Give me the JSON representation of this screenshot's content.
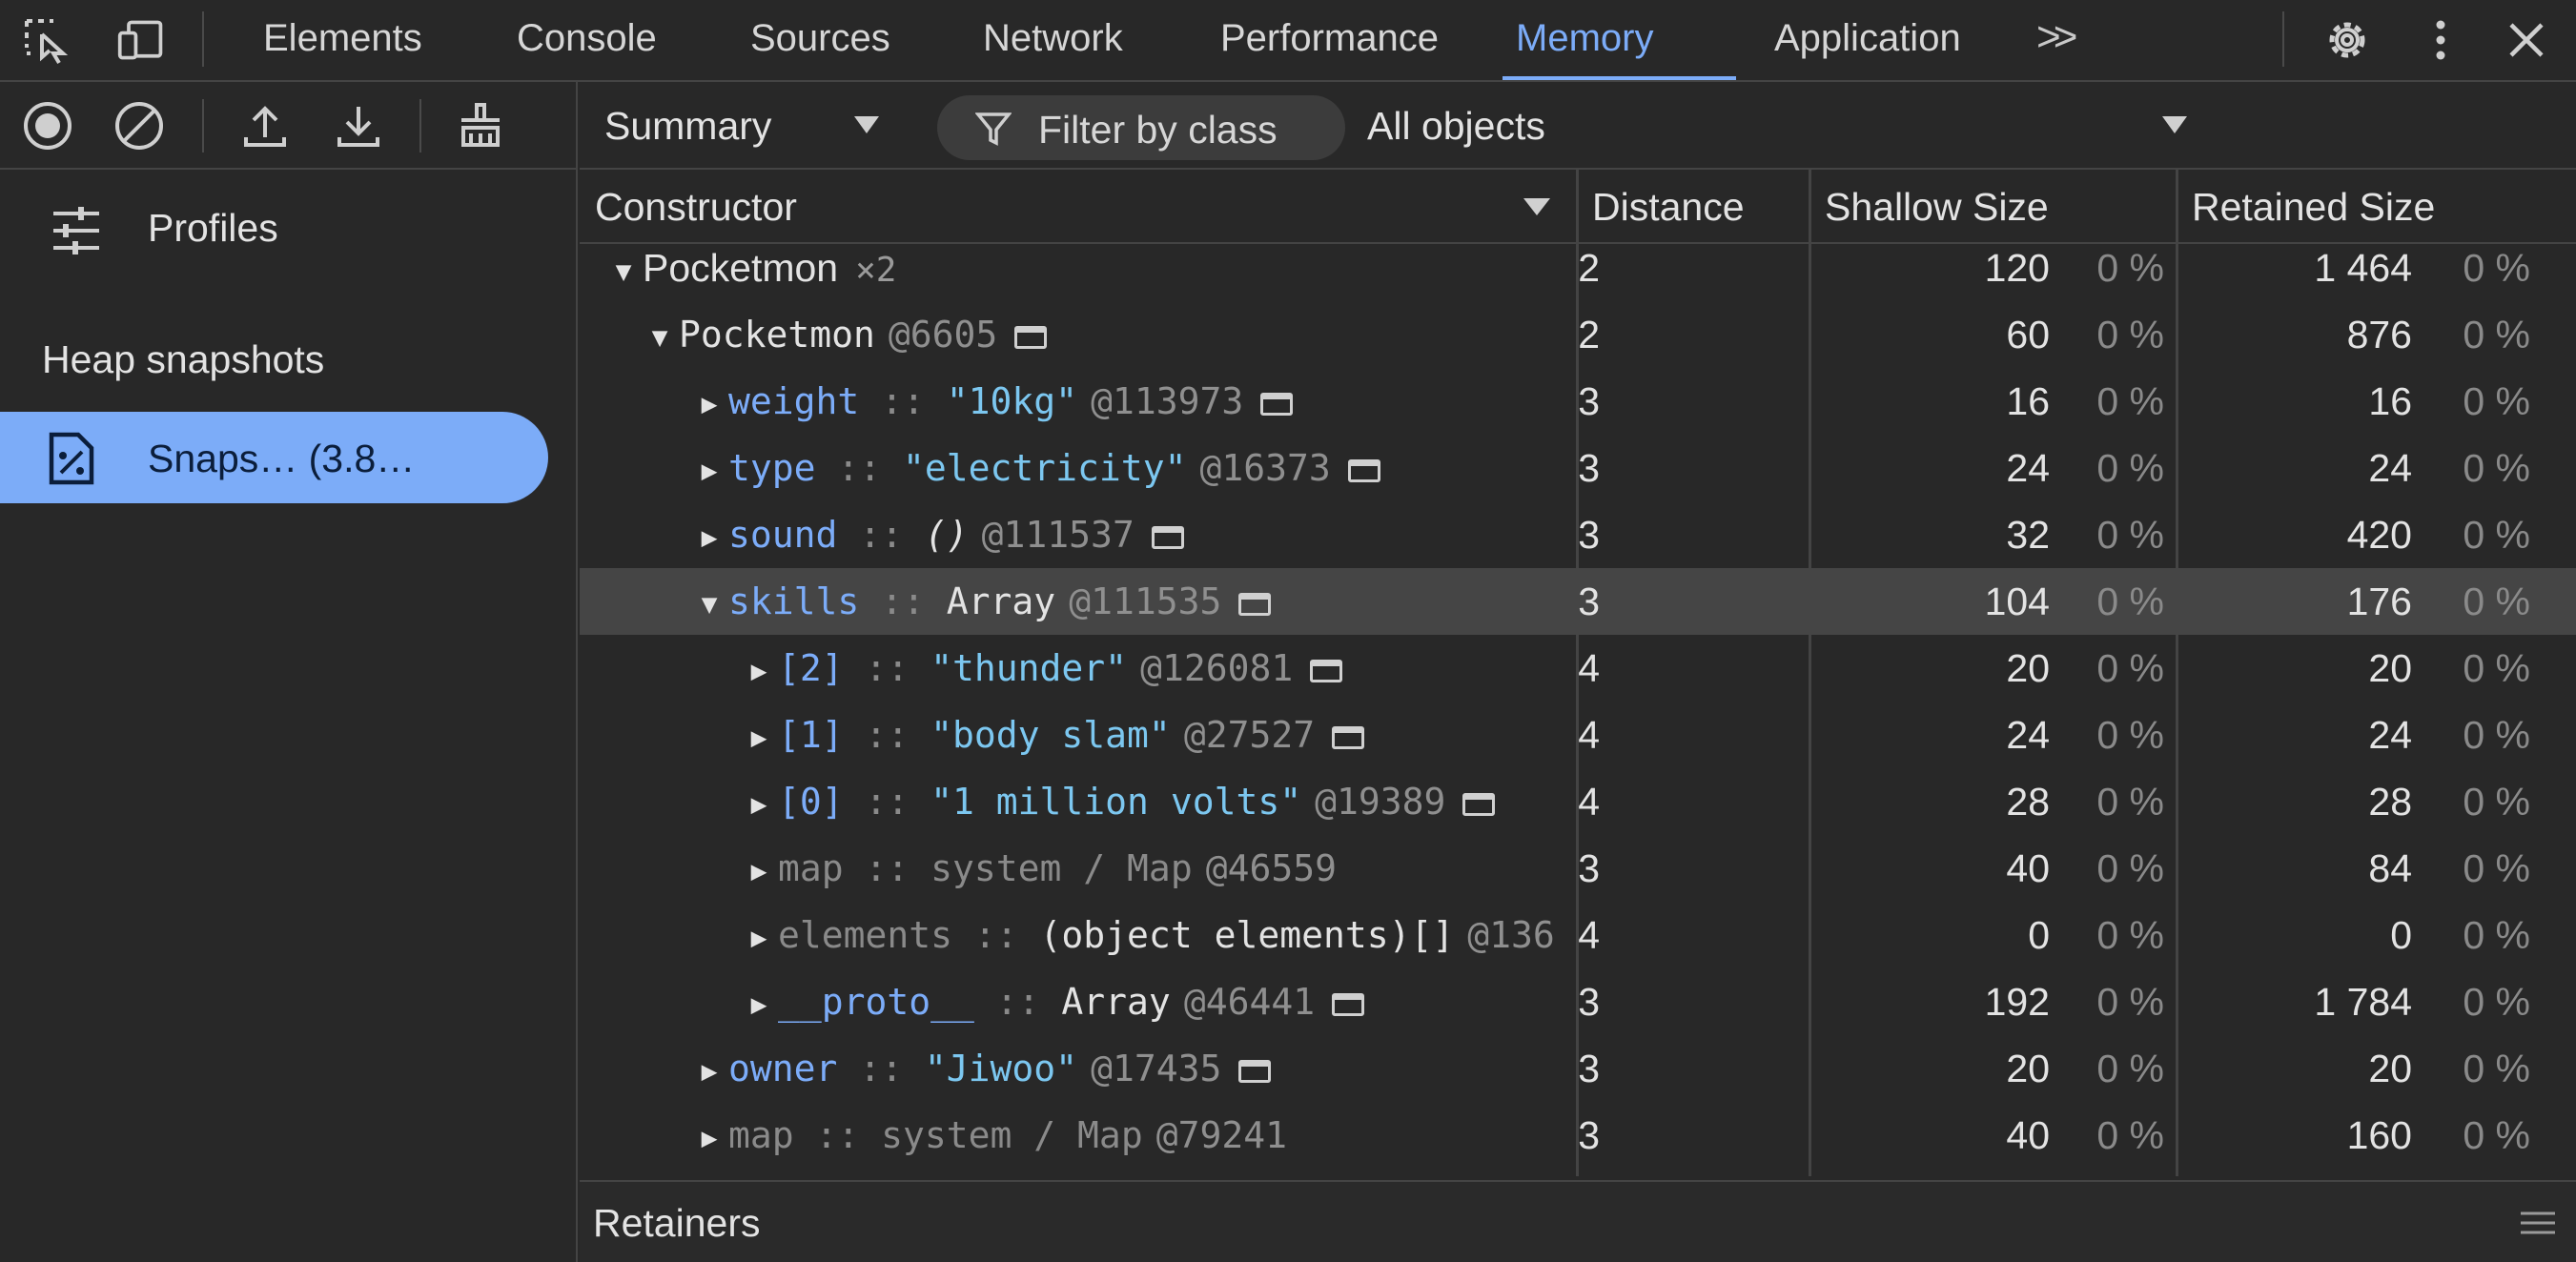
{
  "tabs": {
    "elements": "Elements",
    "console": "Console",
    "sources": "Sources",
    "network": "Network",
    "performance": "Performance",
    "memory": "Memory",
    "application": "Application",
    "more": ">>"
  },
  "sidebar": {
    "profiles_label": "Profiles",
    "heap_title": "Heap snapshots",
    "snapshot_label": "Snaps…  (3.8…"
  },
  "toolbar": {
    "view": "Summary",
    "filter_placeholder": "Filter by class",
    "scope": "All objects"
  },
  "columns": {
    "constructor": "Constructor",
    "distance": "Distance",
    "shallow": "Shallow Size",
    "retained": "Retained Size"
  },
  "rows": [
    {
      "ctor": "Pocketmon",
      "count": "×2",
      "distance": "2",
      "shallow": "120",
      "shallow_pct": "0 %",
      "retained": "1 464",
      "retained_pct": "0 %"
    },
    {
      "obj": "Pocketmon",
      "id": "@6605",
      "distance": "2",
      "shallow": "60",
      "shallow_pct": "0 %",
      "retained": "876",
      "retained_pct": "0 %"
    },
    {
      "prop": "weight",
      "sep": " :: ",
      "val": "\"10kg\"",
      "id": "@113973",
      "distance": "3",
      "shallow": "16",
      "shallow_pct": "0 %",
      "retained": "16",
      "retained_pct": "0 %"
    },
    {
      "prop": "type",
      "sep": " :: ",
      "val": "\"electricity\"",
      "id": "@16373",
      "distance": "3",
      "shallow": "24",
      "shallow_pct": "0 %",
      "retained": "24",
      "retained_pct": "0 %"
    },
    {
      "prop": "sound",
      "sep": " :: ",
      "val": "()",
      "id": "@111537",
      "distance": "3",
      "shallow": "32",
      "shallow_pct": "0 %",
      "retained": "420",
      "retained_pct": "0 %"
    },
    {
      "prop": "skills",
      "sep": " :: ",
      "val": "Array",
      "id": "@111535",
      "distance": "3",
      "shallow": "104",
      "shallow_pct": "0 %",
      "retained": "176",
      "retained_pct": "0 %"
    },
    {
      "prop": "[2]",
      "sep": " :: ",
      "val": "\"thunder\"",
      "id": "@126081",
      "distance": "4",
      "shallow": "20",
      "shallow_pct": "0 %",
      "retained": "20",
      "retained_pct": "0 %"
    },
    {
      "prop": "[1]",
      "sep": " :: ",
      "val": "\"body slam\"",
      "id": "@27527",
      "distance": "4",
      "shallow": "24",
      "shallow_pct": "0 %",
      "retained": "24",
      "retained_pct": "0 %"
    },
    {
      "prop": "[0]",
      "sep": " :: ",
      "val": "\"1 million volts\"",
      "id": "@19389",
      "distance": "4",
      "shallow": "28",
      "shallow_pct": "0 %",
      "retained": "28",
      "retained_pct": "0 %"
    },
    {
      "prop": "map",
      "sep": " :: ",
      "val": "system / Map",
      "id": "@46559",
      "distance": "3",
      "shallow": "40",
      "shallow_pct": "0 %",
      "retained": "84",
      "retained_pct": "0 %"
    },
    {
      "prop": "elements",
      "sep": " :: ",
      "val": "(object elements)[]",
      "id": "@136",
      "distance": "4",
      "shallow": "0",
      "shallow_pct": "0 %",
      "retained": "0",
      "retained_pct": "0 %"
    },
    {
      "prop": "__proto__",
      "sep": " :: ",
      "val": "Array",
      "id": "@46441",
      "distance": "3",
      "shallow": "192",
      "shallow_pct": "0 %",
      "retained": "1 784",
      "retained_pct": "0 %"
    },
    {
      "prop": "owner",
      "sep": " :: ",
      "val": "\"Jiwoo\"",
      "id": "@17435",
      "distance": "3",
      "shallow": "20",
      "shallow_pct": "0 %",
      "retained": "20",
      "retained_pct": "0 %"
    },
    {
      "prop": "map",
      "sep": " :: ",
      "val": "system / Map",
      "id": "@79241",
      "distance": "3",
      "shallow": "40",
      "shallow_pct": "0 %",
      "retained": "160",
      "retained_pct": "0 %"
    }
  ],
  "retainers": {
    "label": "Retainers"
  },
  "colors": {
    "accent": "#7cacf8",
    "background": "#282828",
    "selected_row": "#454545"
  }
}
